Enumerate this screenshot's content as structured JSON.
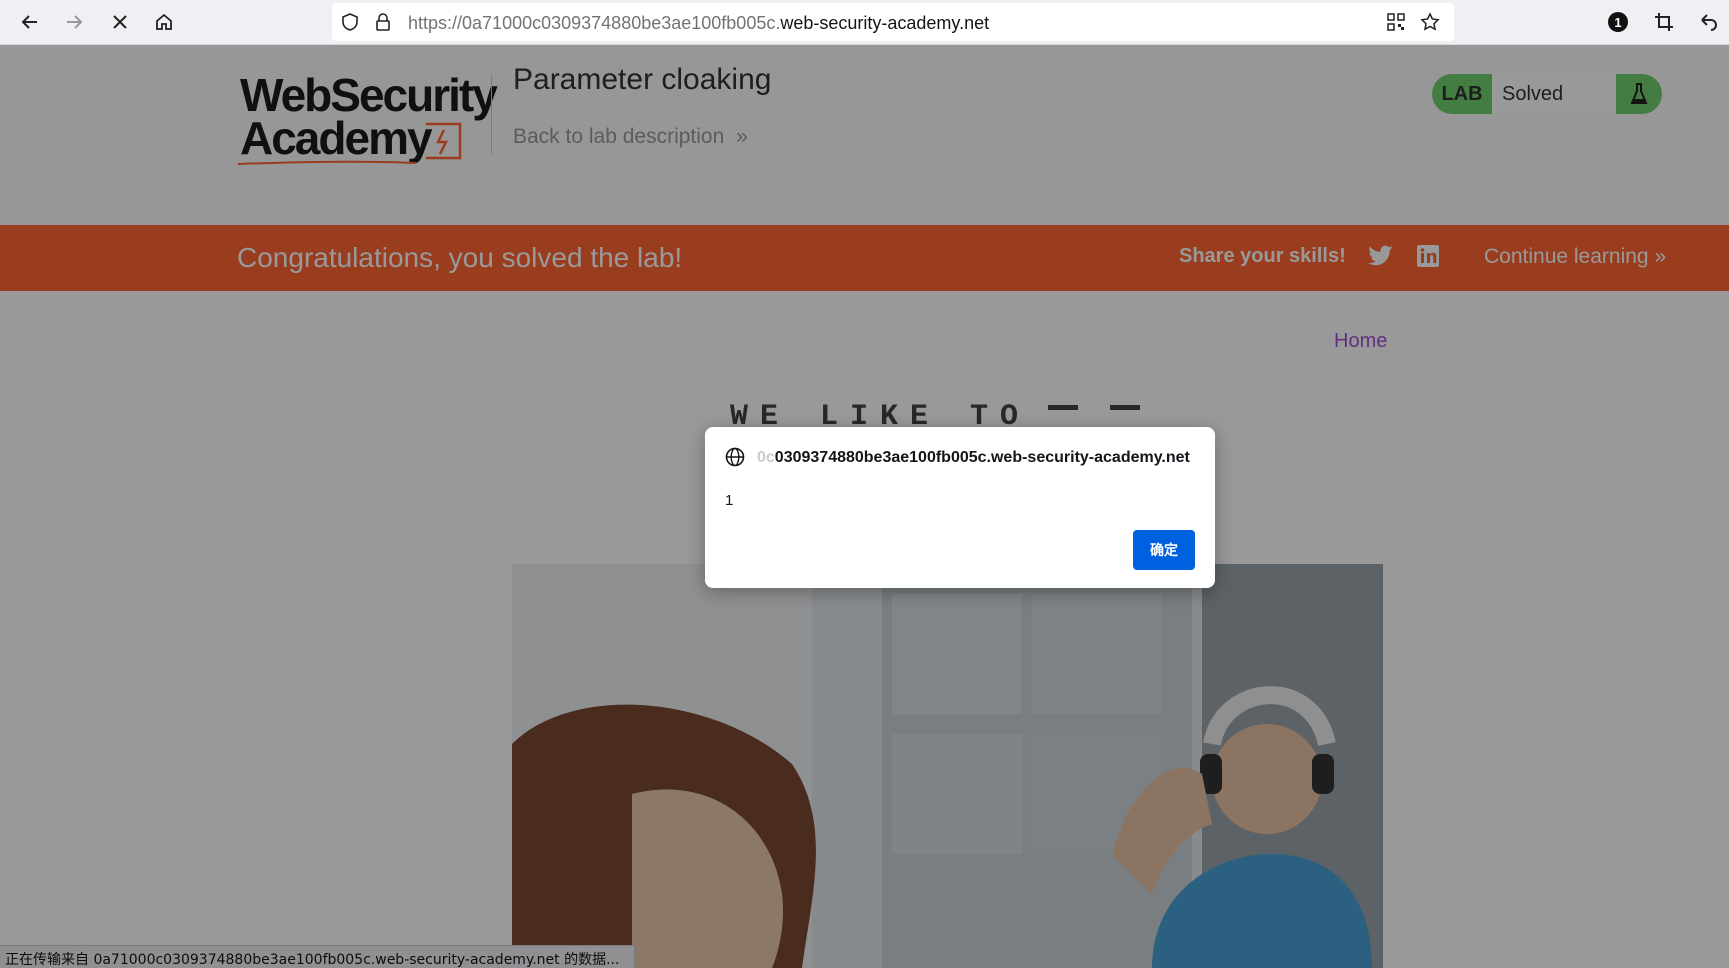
{
  "browser": {
    "url_prefix": "https://0a71000c0309374880be3ae100fb005c.",
    "url_domain": "web-security-academy.net",
    "notification_count": "1",
    "status_text": "正在传输来自 0a71000c0309374880be3ae100fb005c.web-security-academy.net 的数据..."
  },
  "header": {
    "logo_line1": "WebSecurity",
    "logo_line2": "Academy",
    "lab_title": "Parameter cloaking",
    "back_link": "Back to lab description",
    "badge_label": "LAB",
    "badge_status": "Solved"
  },
  "banner": {
    "message": "Congratulations, you solved the lab!",
    "share": "Share your skills!",
    "continue": "Continue learning"
  },
  "content": {
    "home": "Home",
    "hero_text": "WE LIKE TO"
  },
  "dialog": {
    "origin_faded": "0c",
    "origin": "0309374880be3ae100fb005c.web-security-academy.net",
    "message": "1",
    "ok_label": "确定"
  },
  "colors": {
    "banner": "#ff6633",
    "badge": "#70d16d",
    "ok_button": "#0061e0",
    "home_link": "#a94fd6"
  }
}
